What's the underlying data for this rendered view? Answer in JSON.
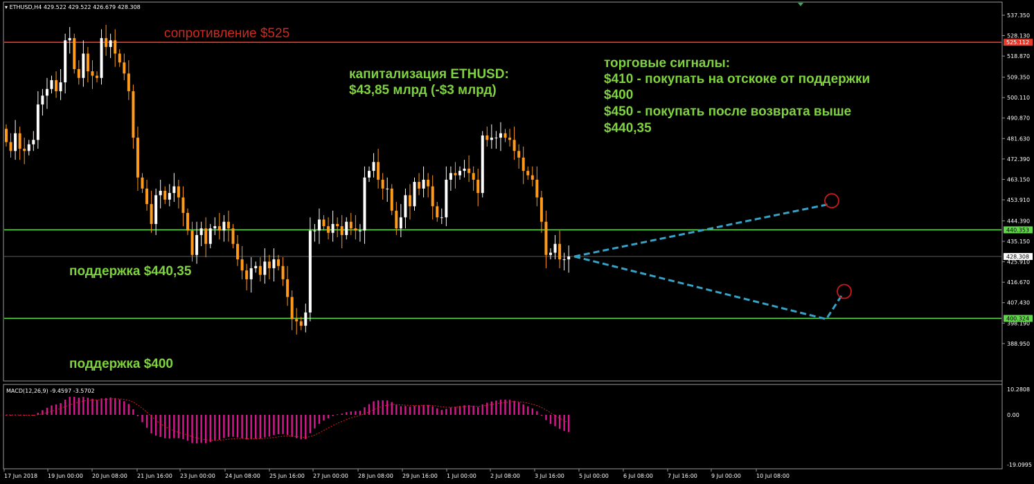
{
  "header": {
    "symbol": "ETHUSD,H4",
    "ohlc": "429.522 429.522 426.679 428.308",
    "macd_label": "MACD(12,26,9) -9.4597 -3.5702"
  },
  "annotations": {
    "resistance": "сопротивление $525",
    "cap_title": "капитализация ETHUSD:",
    "cap_value": "$43,85 млрд (-$3 млрд)",
    "signals": [
      "торговые сигналы:",
      "$410 - покупать на отскоке от поддержки",
      "$400",
      "$450 - покупать после возврата выше",
      "$440,35"
    ],
    "support1": "поддержка $440,35",
    "support2": "поддержка $400"
  },
  "colors": {
    "background": "#000000",
    "bull": "#ffffff",
    "bear": "#ff9a1a",
    "resistance_line": "#e8392a",
    "support_line": "#62d64a",
    "macd_hist": "#d6198e",
    "macd_signal": "#d62020",
    "projection": "#35a3c8",
    "target_circle": "#cc1a1a"
  },
  "chart_data": [
    {
      "type": "candlestick",
      "symbol": "ETHUSD",
      "timeframe": "H4",
      "x_tick_labels": [
        "17 Jun 2018",
        "19 Jun 00:00",
        "20 Jun 08:00",
        "21 Jun 16:00",
        "23 Jun 00:00",
        "24 Jun 08:00",
        "25 Jun 16:00",
        "27 Jun 00:00",
        "28 Jun 08:00",
        "29 Jun 16:00",
        "1 Jul 00:00",
        "2 Jul 08:00",
        "3 Jul 16:00",
        "5 Jul 00:00",
        "6 Jul 08:00",
        "7 Jul 16:00",
        "9 Jul 00:00",
        "10 Jul 08:00"
      ],
      "y_tick_labels": [
        "537.350",
        "528.130",
        "518.870",
        "509.350",
        "500.110",
        "490.870",
        "481.630",
        "472.390",
        "463.150",
        "453.910",
        "444.390",
        "435.150",
        "425.910",
        "416.670",
        "407.430",
        "398.190",
        "388.950"
      ],
      "ylim": [
        386,
        540
      ],
      "horizontal_levels": [
        {
          "label": "525.112",
          "value": 525.112,
          "kind": "resistance"
        },
        {
          "label": "440.353",
          "value": 440.353,
          "kind": "support"
        },
        {
          "label": "400.324",
          "value": 400.324,
          "kind": "support"
        }
      ],
      "current_price_label": "428.308",
      "current_price": 428.308,
      "closes": [
        480,
        476,
        484,
        477,
        476,
        479,
        481,
        497,
        501,
        504,
        508,
        503,
        507,
        526,
        527,
        513,
        509,
        520,
        512,
        510,
        509,
        527,
        523,
        526,
        520,
        516,
        511,
        503,
        482,
        464,
        459,
        452,
        443,
        456,
        458,
        454,
        457,
        460,
        455,
        448,
        440,
        429,
        438,
        441,
        434,
        441,
        442,
        440,
        444,
        441,
        434,
        427,
        422,
        418,
        423,
        424,
        420,
        426,
        423,
        427,
        424,
        418,
        410,
        400,
        399,
        397,
        403,
        440,
        440,
        445,
        442,
        439,
        443,
        442,
        438,
        444,
        441,
        440,
        440,
        464,
        467,
        471,
        463,
        459,
        459,
        449,
        441,
        446,
        456,
        451,
        462,
        459,
        463,
        460,
        451,
        446,
        446,
        463,
        466,
        465,
        467,
        468,
        466,
        463,
        457,
        483,
        481,
        482,
        482,
        484,
        482,
        481,
        476,
        473,
        467,
        465,
        463,
        455,
        444,
        429,
        430,
        434,
        427,
        427,
        428.308
      ],
      "trade_signals": [
        {
          "action": "buy on rebound from support",
          "price": 410
        },
        {
          "action": "buy after return above",
          "price": 450
        }
      ],
      "projection_points": [
        [
          428.3,
          "now"
        ],
        [
          452,
          "up"
        ],
        [
          400,
          "down"
        ],
        [
          410,
          "up"
        ]
      ]
    },
    {
      "type": "bar",
      "name": "MACD(12,26,9)",
      "main": -9.4597,
      "signal": -3.5702,
      "y_tick_labels": [
        "10.2808",
        "0.00",
        "-19.0995"
      ],
      "ylim": [
        -19.0995,
        10.2808
      ]
    }
  ]
}
